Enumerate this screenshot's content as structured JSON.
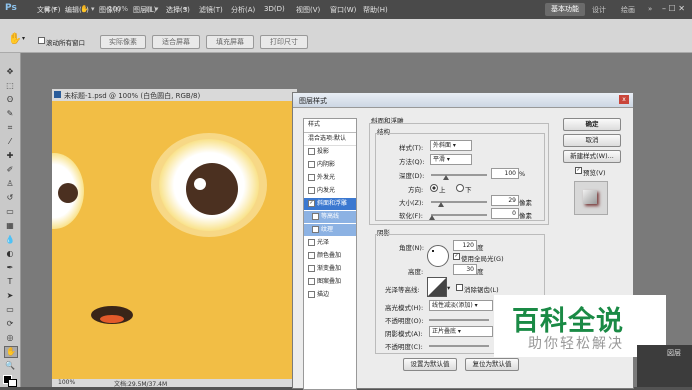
{
  "app": {
    "logo": "Ps",
    "menus": [
      "文件(F)",
      "编辑(E)",
      "图像(I)",
      "图层(L)",
      "选择(S)",
      "滤镜(T)",
      "分析(A)",
      "3D(D)",
      "视图(V)",
      "窗口(W)",
      "帮助(H)"
    ],
    "zoom": "100%",
    "workspaces": {
      "basic": "基本功能",
      "design": "设计",
      "draw": "绘画",
      "more": "»"
    },
    "window_buttons": "– ☐ ✕"
  },
  "options_bar": {
    "scroll_all": "滚动所有窗口",
    "buttons": [
      "实际像素",
      "适合屏幕",
      "填充屏幕",
      "打印尺寸"
    ]
  },
  "document": {
    "title": "未标题-1.psd @ 100% (白色圆白, RGB/8)",
    "status_zoom": "100%",
    "status_doc": "文档:29.5M/37.4M"
  },
  "dialog": {
    "title": "图层样式",
    "close": "x",
    "styles_header": "样式",
    "blend_options": "混合选项:默认",
    "items": [
      {
        "label": "投影",
        "checked": false
      },
      {
        "label": "内阴影",
        "checked": false
      },
      {
        "label": "外发光",
        "checked": false
      },
      {
        "label": "内发光",
        "checked": false
      },
      {
        "label": "斜面和浮雕",
        "checked": true
      },
      {
        "label": "等高线",
        "checked": false
      },
      {
        "label": "纹理",
        "checked": false
      },
      {
        "label": "光泽",
        "checked": false
      },
      {
        "label": "颜色叠加",
        "checked": false
      },
      {
        "label": "渐变叠加",
        "checked": false
      },
      {
        "label": "图案叠加",
        "checked": false
      },
      {
        "label": "描边",
        "checked": false
      }
    ],
    "bevel": {
      "section": "斜面和浮雕",
      "structure": "结构",
      "style_label": "样式(T):",
      "style_value": "外斜面",
      "method_label": "方法(Q):",
      "method_value": "平滑",
      "depth_label": "深度(D):",
      "depth_value": "100",
      "depth_unit": "%",
      "direction_label": "方向:",
      "dir_up": "上",
      "dir_down": "下",
      "size_label": "大小(Z):",
      "size_value": "29",
      "size_unit": "像素",
      "soften_label": "软化(F):",
      "soften_value": "0",
      "soften_unit": "像素"
    },
    "shading": {
      "section": "阴影",
      "angle_label": "角度(N):",
      "angle_value": "120",
      "angle_unit": "度",
      "global_light": "使用全局光(G)",
      "altitude_label": "高度:",
      "altitude_value": "30",
      "altitude_unit": "度",
      "gloss_label": "光泽等高线:",
      "antialias": "消除锯齿(L)",
      "highlight_label": "高光模式(H):",
      "highlight_value": "线性减淡(添加)",
      "opacity1_label": "不透明度(O):",
      "shadow_label": "阴影模式(A):",
      "shadow_value": "正片叠底",
      "opacity2_label": "不透明度(C):"
    },
    "buttons": {
      "ok": "确定",
      "cancel": "取消",
      "new_style": "新建样式(W)...",
      "preview": "预览(V)",
      "make_default": "设置为默认值",
      "reset_default": "复位为默认值"
    }
  },
  "watermark": {
    "big": "百科全说",
    "small": "助你轻松解决"
  },
  "right_panel": {
    "label": "図层"
  }
}
